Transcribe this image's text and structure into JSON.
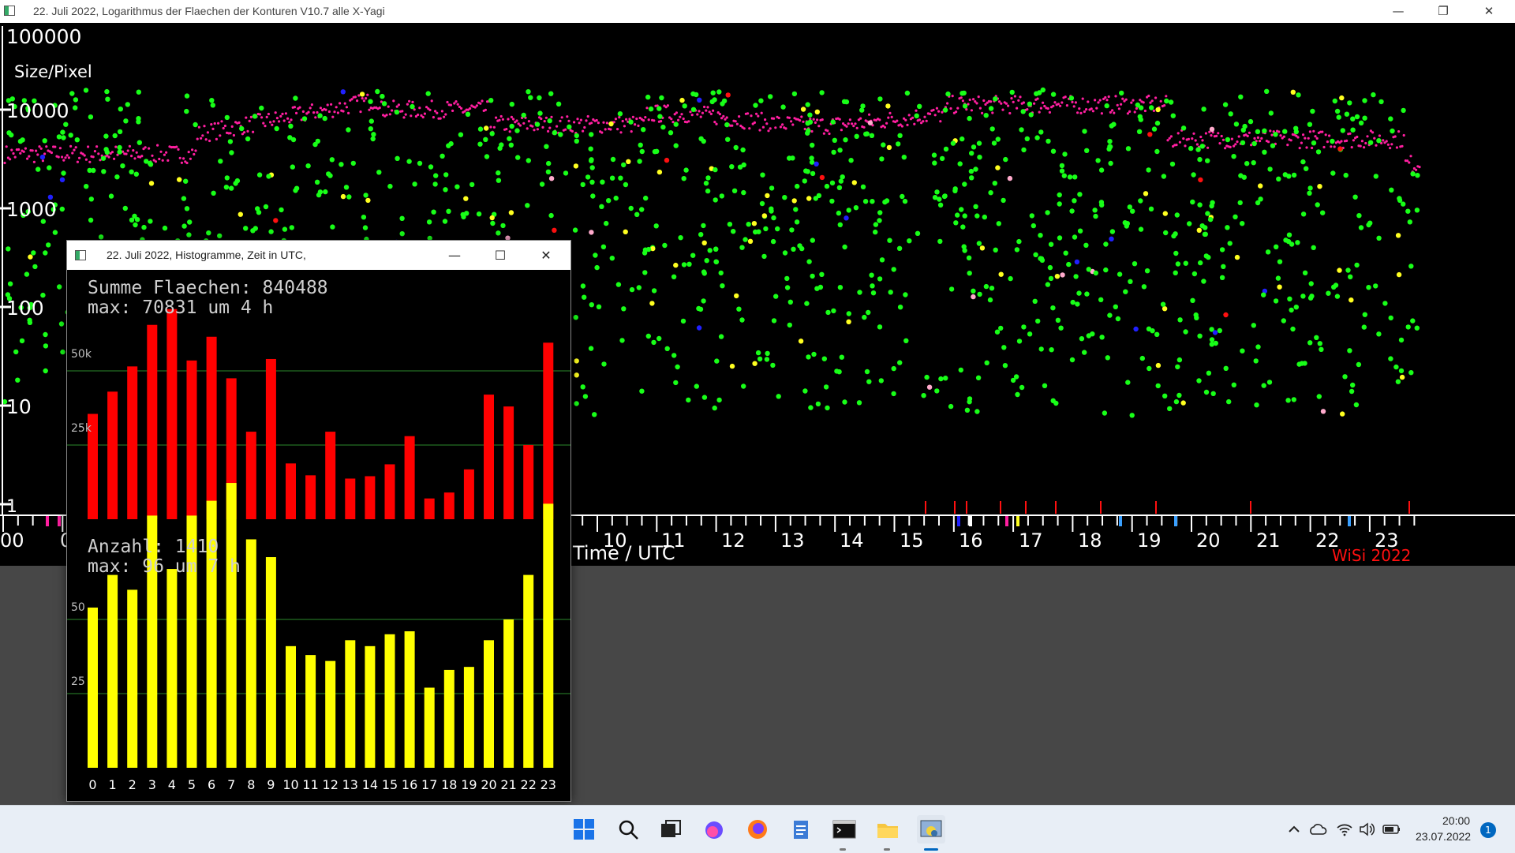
{
  "main_window": {
    "title": "22. Juli 2022, Logarithmus der Flaechen der Konturen V10.7 alle X-Yagi",
    "controls": {
      "minimize": "—",
      "restore": "❐",
      "close": "✕"
    }
  },
  "log_plot": {
    "y_label": "Size/Pixel",
    "y_ticks": [
      "100000",
      "10000",
      "1000",
      "100",
      "10",
      "1"
    ],
    "x_ticks": [
      "00",
      "0",
      "10",
      "11",
      "12",
      "13",
      "14",
      "15",
      "16",
      "17",
      "18",
      "19",
      "20",
      "21",
      "22",
      "23"
    ],
    "x_label": "Time / UTC",
    "credit": "WiSi 2022",
    "colors": {
      "background": "#000000",
      "main_series": "#ff1fa0",
      "meteors": "#18ff18",
      "bright": "#ffff20",
      "red": "#ff1010",
      "blue": "#2020ff",
      "pink": "#ffaacc",
      "axis": "#ffffff",
      "credit": "#ff1010"
    }
  },
  "histogram_window": {
    "title": "22. Juli 2022, Histogramme, Zeit in UTC,",
    "controls": {
      "minimize": "—",
      "maximize": "☐",
      "close": "✕"
    },
    "summary_line1": "Summe Flaechen: 840488",
    "summary_line2": "max: 70831 um 4 h",
    "count_line1": "Anzahl: 1410",
    "count_line2": "max: 96 um 7 h",
    "area_gridlines": [
      "50k",
      "25k"
    ],
    "count_gridlines": [
      "50",
      "25"
    ],
    "hours": [
      "0",
      "1",
      "2",
      "3",
      "4",
      "5",
      "6",
      "7",
      "8",
      "9",
      "10",
      "11",
      "12",
      "13",
      "14",
      "15",
      "16",
      "17",
      "18",
      "19",
      "20",
      "21",
      "22",
      "23"
    ],
    "colors": {
      "area_bars": "#ff0000",
      "count_bars": "#ffff00",
      "gridline": "#2d8a2d",
      "text": "#cfcfcf",
      "axis_text": "#ffffff"
    }
  },
  "chart_data": [
    {
      "type": "bar",
      "title": "Summe Flaechen: 840488",
      "categories": [
        "0",
        "1",
        "2",
        "3",
        "4",
        "5",
        "6",
        "7",
        "8",
        "9",
        "10",
        "11",
        "12",
        "13",
        "14",
        "15",
        "16",
        "17",
        "18",
        "19",
        "20",
        "21",
        "22",
        "23"
      ],
      "series": [
        {
          "name": "Summe Flaechen",
          "values": [
            35500,
            43000,
            51500,
            65500,
            70831,
            53500,
            61500,
            47500,
            29500,
            54000,
            18800,
            14800,
            29500,
            13700,
            14500,
            18500,
            28000,
            7000,
            9000,
            16800,
            42000,
            38000,
            25000,
            59500
          ]
        }
      ],
      "ylim": [
        0,
        75000
      ],
      "gridlines": [
        25000,
        50000
      ]
    },
    {
      "type": "bar",
      "title": "Anzahl: 1410",
      "categories": [
        "0",
        "1",
        "2",
        "3",
        "4",
        "5",
        "6",
        "7",
        "8",
        "9",
        "10",
        "11",
        "12",
        "13",
        "14",
        "15",
        "16",
        "17",
        "18",
        "19",
        "20",
        "21",
        "22",
        "23"
      ],
      "series": [
        {
          "name": "Anzahl",
          "values": [
            54,
            65,
            60,
            85,
            67,
            85,
            90,
            96,
            77,
            71,
            41,
            38,
            36,
            43,
            41,
            45,
            46,
            27,
            33,
            34,
            43,
            50,
            65,
            89
          ]
        }
      ],
      "ylim": [
        0,
        100
      ],
      "gridlines": [
        25,
        50
      ]
    }
  ],
  "taskbar": {
    "clock_time": "20:00",
    "clock_date": "23.07.2022",
    "notification_count": "1",
    "icons": [
      "windows-start-icon",
      "search-icon",
      "task-view-icon",
      "firefox-nightly-icon",
      "firefox-icon",
      "notepad-icon",
      "terminal-icon",
      "file-explorer-icon",
      "python-app-icon"
    ]
  }
}
